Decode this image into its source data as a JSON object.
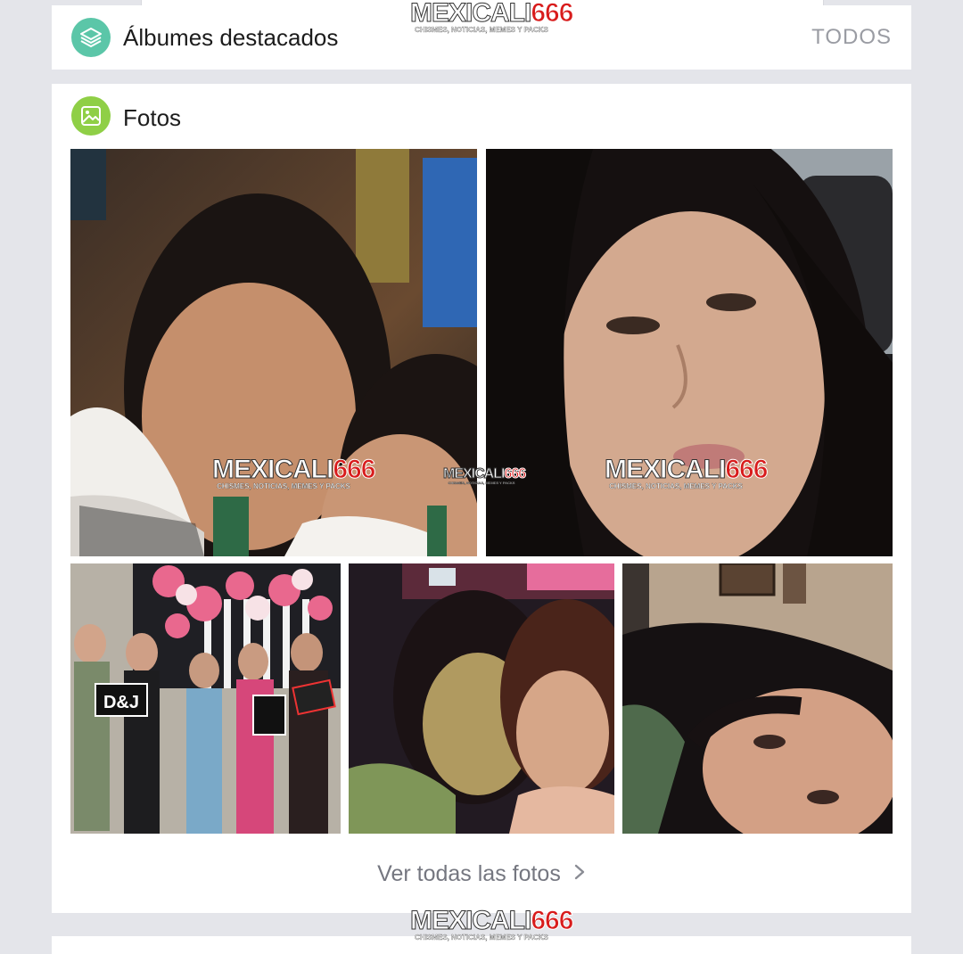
{
  "watermark": {
    "brand_a": "MEXICALI",
    "brand_b": "666",
    "tagline": "CHISMES, NOTICIAS, MEMES Y PACKS"
  },
  "albums": {
    "title": "Álbumes destacados",
    "action": "TODOS"
  },
  "photos": {
    "title": "Fotos",
    "see_all": "Ver todas las fotos",
    "chevron": "›"
  },
  "icons": {
    "albums": "layers-icon",
    "photos": "image-icon",
    "chevron": "chevron-right-icon"
  },
  "colors": {
    "albums_icon_bg": "#5bc6a8",
    "photos_icon_bg": "#8fcf46",
    "background": "#e4e5ea",
    "brand_red": "#d81c1c"
  }
}
